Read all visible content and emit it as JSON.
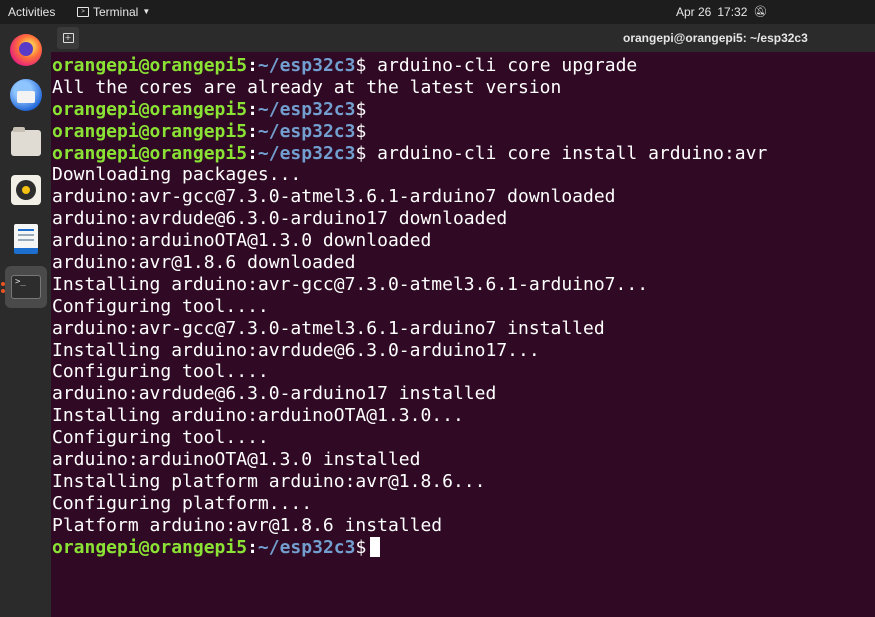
{
  "topbar": {
    "activities": "Activities",
    "app_name": "Terminal",
    "date": "Apr 26",
    "time": "17:32"
  },
  "dock": {
    "items": [
      "firefox",
      "thunderbird",
      "files",
      "rhythmbox",
      "libreoffice-writer",
      "terminal"
    ],
    "terminal_glyph": ">_"
  },
  "window": {
    "title": "orangepi@orangepi5: ~/esp32c3"
  },
  "terminal": {
    "prompt_user": "orangepi@orangepi5",
    "prompt_sep": ":",
    "prompt_path": "~/esp32c3",
    "prompt_end": "$",
    "lines": [
      {
        "type": "prompt",
        "cmd": "arduino-cli core upgrade"
      },
      {
        "type": "out",
        "text": "All the cores are already at the latest version"
      },
      {
        "type": "prompt",
        "cmd": ""
      },
      {
        "type": "prompt",
        "cmd": ""
      },
      {
        "type": "prompt",
        "cmd": "arduino-cli core install arduino:avr"
      },
      {
        "type": "out",
        "text": "Downloading packages..."
      },
      {
        "type": "out",
        "text": "arduino:avr-gcc@7.3.0-atmel3.6.1-arduino7 downloaded"
      },
      {
        "type": "out",
        "text": "arduino:avrdude@6.3.0-arduino17 downloaded"
      },
      {
        "type": "out",
        "text": "arduino:arduinoOTA@1.3.0 downloaded"
      },
      {
        "type": "out",
        "text": "arduino:avr@1.8.6 downloaded"
      },
      {
        "type": "out",
        "text": "Installing arduino:avr-gcc@7.3.0-atmel3.6.1-arduino7..."
      },
      {
        "type": "out",
        "text": "Configuring tool...."
      },
      {
        "type": "out",
        "text": "arduino:avr-gcc@7.3.0-atmel3.6.1-arduino7 installed"
      },
      {
        "type": "out",
        "text": "Installing arduino:avrdude@6.3.0-arduino17..."
      },
      {
        "type": "out",
        "text": "Configuring tool...."
      },
      {
        "type": "out",
        "text": "arduino:avrdude@6.3.0-arduino17 installed"
      },
      {
        "type": "out",
        "text": "Installing arduino:arduinoOTA@1.3.0..."
      },
      {
        "type": "out",
        "text": "Configuring tool...."
      },
      {
        "type": "out",
        "text": "arduino:arduinoOTA@1.3.0 installed"
      },
      {
        "type": "out",
        "text": "Installing platform arduino:avr@1.8.6..."
      },
      {
        "type": "out",
        "text": "Configuring platform...."
      },
      {
        "type": "out",
        "text": "Platform arduino:avr@1.8.6 installed"
      },
      {
        "type": "prompt",
        "cmd": "",
        "cursor": true
      }
    ]
  }
}
